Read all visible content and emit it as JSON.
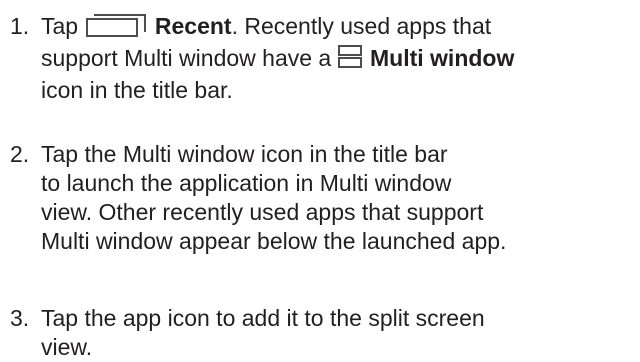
{
  "steps": [
    {
      "number": "1.",
      "lines": {
        "l1_pre": "Tap",
        "l1_bold": "Recent",
        "l1_post": ". Recently used apps that",
        "l2_pre": "support Multi window have a",
        "l2_bold": "Multi window",
        "l3": "icon in the title bar."
      },
      "icons": [
        "recent-apps-icon",
        "multi-window-icon"
      ]
    },
    {
      "number": "2.",
      "lines": [
        "Tap the Multi window icon in the title bar",
        "to launch the application in Multi window",
        "view. Other recently used apps that support",
        "Multi window appear below the launched app."
      ]
    },
    {
      "number": "3.",
      "lines": [
        "Tap the app icon to add it to the split screen",
        "view."
      ]
    }
  ]
}
